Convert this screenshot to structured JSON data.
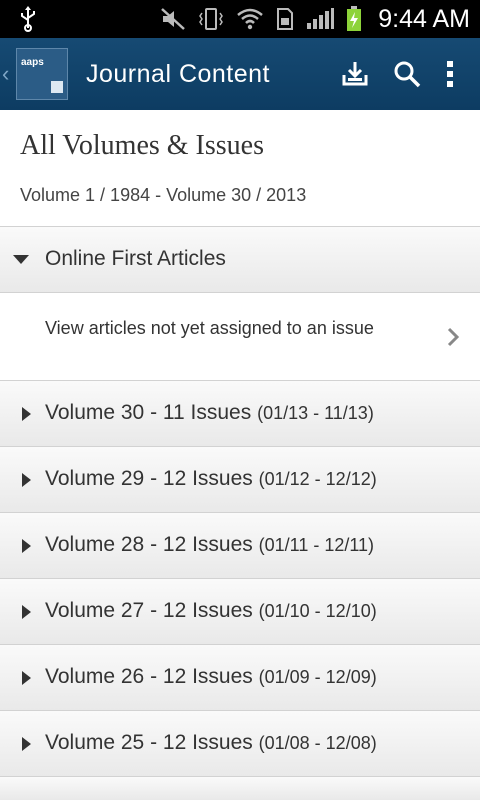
{
  "status_bar": {
    "time": "9:44 AM",
    "icons": [
      "usb-icon",
      "mute-icon",
      "vibrate-icon",
      "wifi-icon",
      "sim-icon",
      "signal-icon",
      "battery-charging-icon"
    ]
  },
  "action_bar": {
    "title": "Journal Content",
    "logo_text": "aaps",
    "icons": [
      "download-icon",
      "search-icon",
      "overflow-menu-icon"
    ]
  },
  "header": {
    "title": "All Volumes & Issues",
    "subtitle": "Volume 1 / 1984 - Volume 30 / 2013"
  },
  "online_first": {
    "label": "Online First Articles",
    "expanded": true,
    "sub_item": "View articles not yet assigned to an issue"
  },
  "volumes": [
    {
      "label": "Volume 30 - 11 Issues",
      "range": "(01/13  -  11/13)"
    },
    {
      "label": "Volume 29 - 12 Issues",
      "range": "(01/12  -  12/12)"
    },
    {
      "label": "Volume 28 - 12 Issues",
      "range": "(01/11  -  12/11)"
    },
    {
      "label": "Volume 27 - 12 Issues",
      "range": "(01/10  -  12/10)"
    },
    {
      "label": "Volume 26 - 12 Issues",
      "range": "(01/09  -  12/09)"
    },
    {
      "label": "Volume 25 - 12 Issues",
      "range": "(01/08  -  12/08)"
    }
  ],
  "colors": {
    "action_bar": "#164a73",
    "status_bar": "#000000",
    "battery": "#8dd33a"
  }
}
